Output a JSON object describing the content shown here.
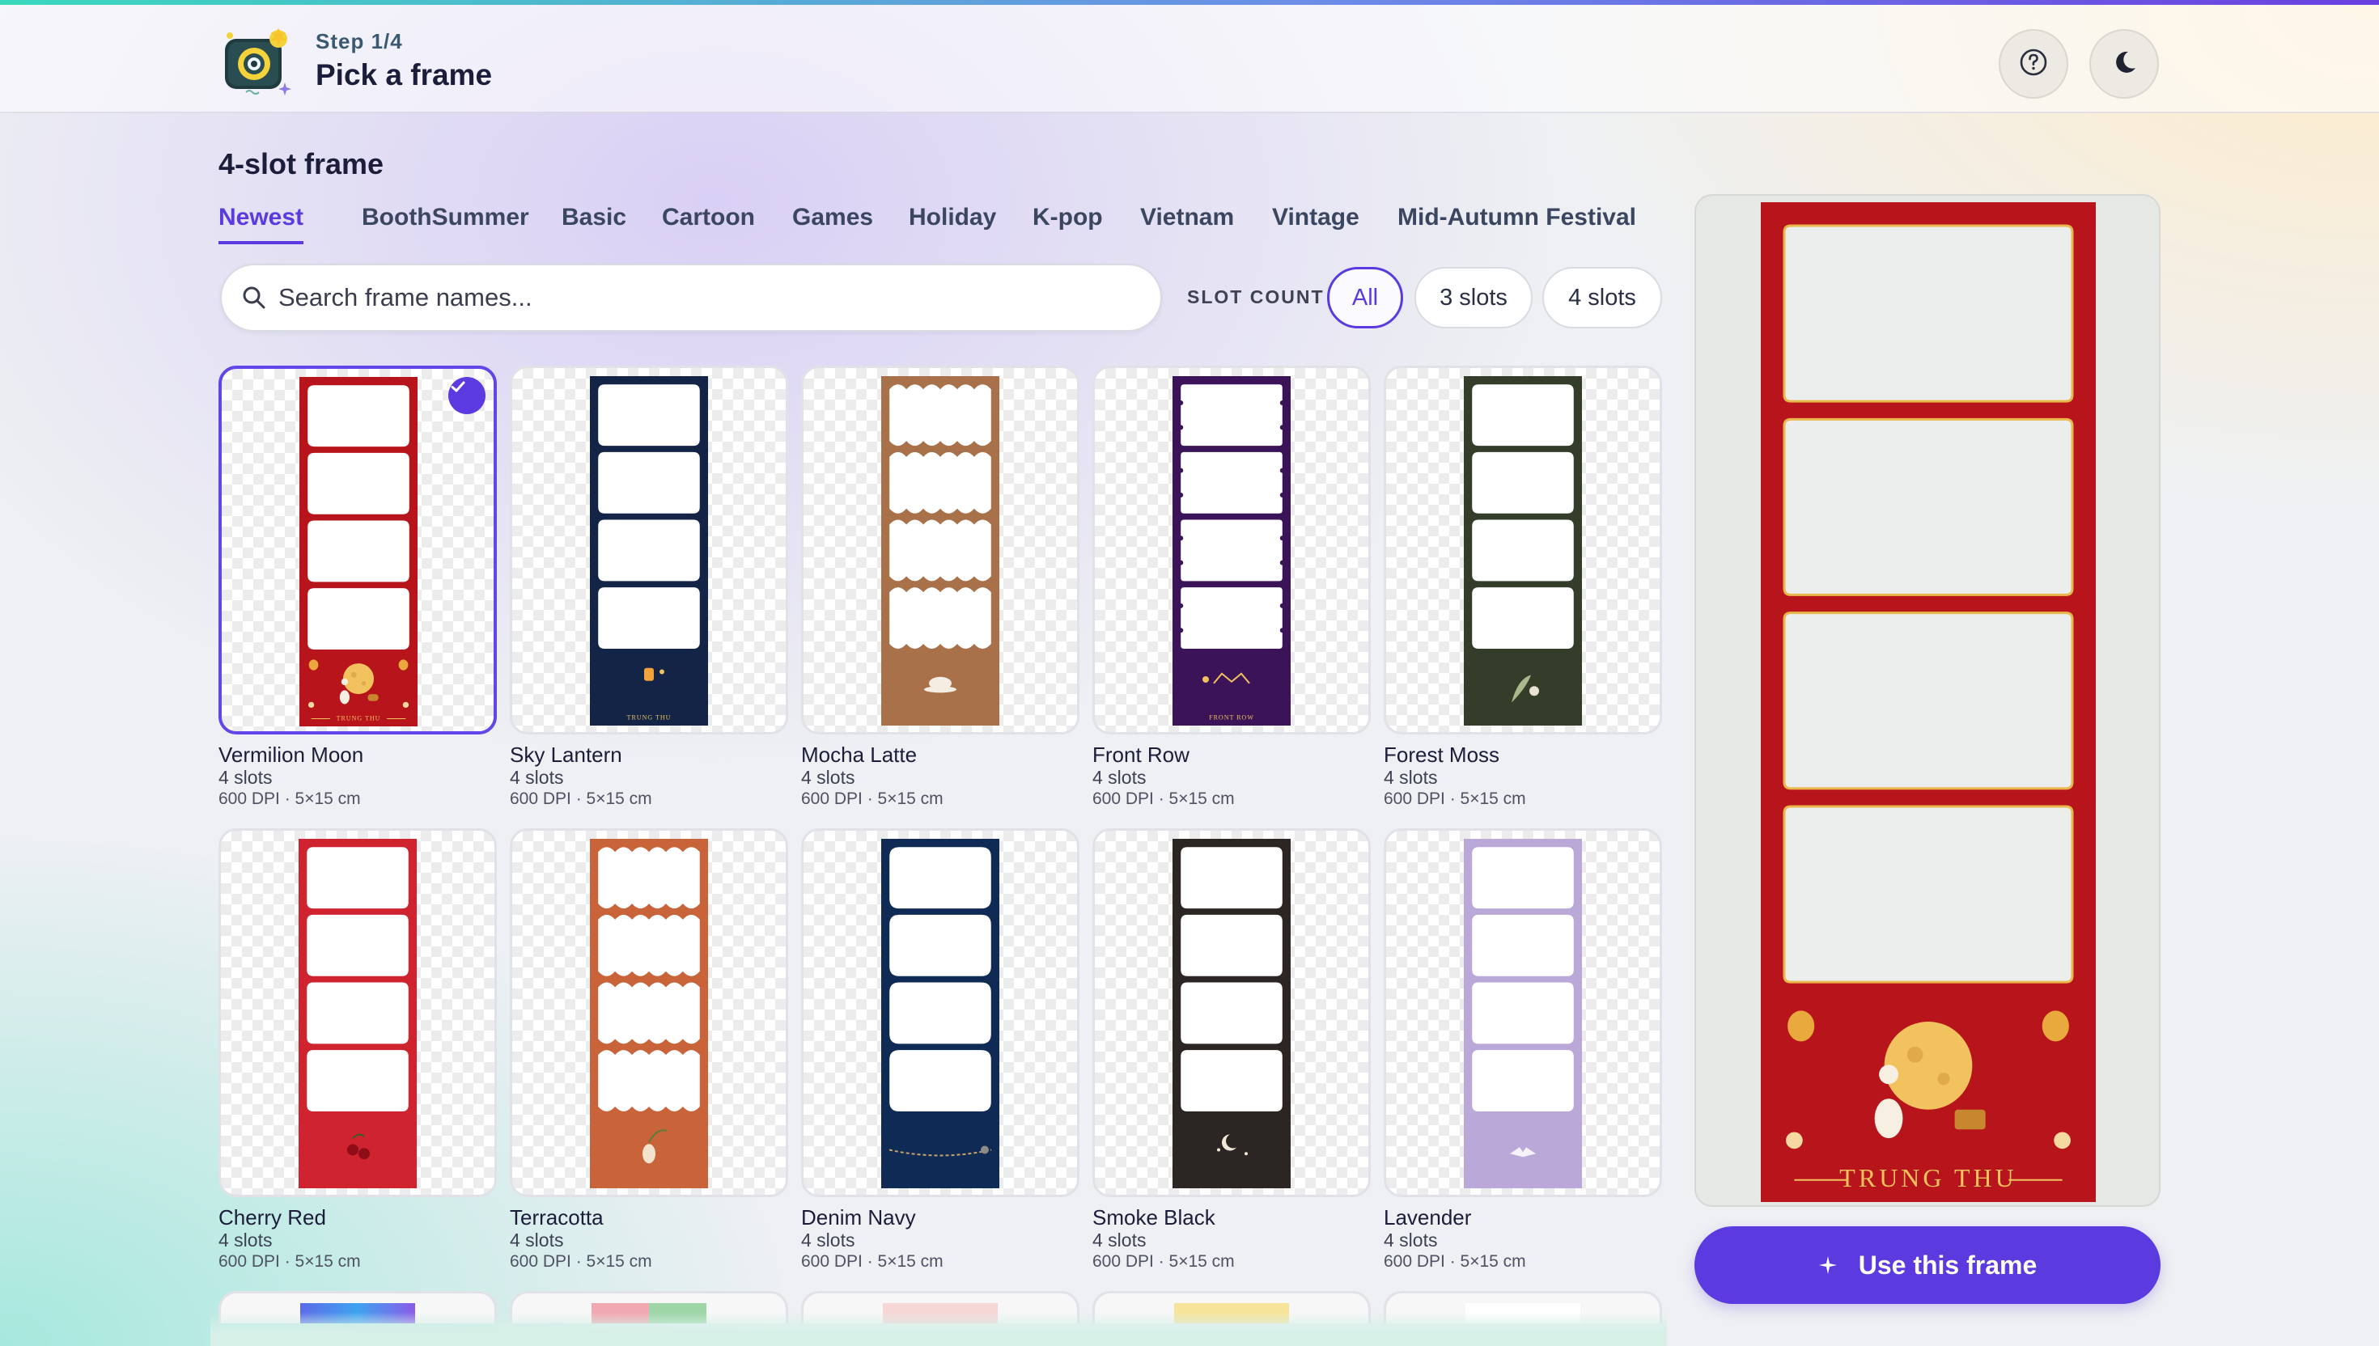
{
  "header": {
    "step": "Step 1/4",
    "title": "Pick a frame",
    "help_icon": "question-circle-icon",
    "theme_icon": "moon-icon"
  },
  "section_title": "4-slot frame",
  "tabs": [
    {
      "label": "Newest",
      "active": true
    },
    {
      "label": "BoothSummer"
    },
    {
      "label": "Basic"
    },
    {
      "label": "Cartoon"
    },
    {
      "label": "Games"
    },
    {
      "label": "Holiday"
    },
    {
      "label": "K-pop"
    },
    {
      "label": "Vietnam"
    },
    {
      "label": "Vintage"
    },
    {
      "label": "Mid-Autumn Festival"
    }
  ],
  "search": {
    "placeholder": "Search frame names...",
    "value": ""
  },
  "slot_filter": {
    "label": "SLOT COUNT",
    "options": [
      {
        "label": "All",
        "active": true
      },
      {
        "label": "3 slots"
      },
      {
        "label": "4 slots"
      }
    ]
  },
  "frames": [
    {
      "name": "Vermilion Moon",
      "slots": "4 slots",
      "meta": "600 DPI · 5×15 cm",
      "color": "#b8141c",
      "style": "square",
      "selected": true,
      "caption": "TRUNG THU"
    },
    {
      "name": "Sky Lantern",
      "slots": "4 slots",
      "meta": "600 DPI · 5×15 cm",
      "color": "#132447",
      "style": "square",
      "caption": "TRUNG THU"
    },
    {
      "name": "Mocha Latte",
      "slots": "4 slots",
      "meta": "600 DPI · 5×15 cm",
      "color": "#a9714a",
      "style": "wavy",
      "caption": ""
    },
    {
      "name": "Front Row",
      "slots": "4 slots",
      "meta": "600 DPI · 5×15 cm",
      "color": "#3a1358",
      "style": "ticket",
      "caption": "FRONT ROW"
    },
    {
      "name": "Forest Moss",
      "slots": "4 slots",
      "meta": "600 DPI · 5×15 cm",
      "color": "#343d2a",
      "style": "square",
      "caption": ""
    },
    {
      "name": "Cherry Red",
      "slots": "4 slots",
      "meta": "600 DPI · 5×15 cm",
      "color": "#cf2430",
      "style": "square",
      "caption": ""
    },
    {
      "name": "Terracotta",
      "slots": "4 slots",
      "meta": "600 DPI · 5×15 cm",
      "color": "#c9643a",
      "style": "wavy",
      "caption": ""
    },
    {
      "name": "Denim Navy",
      "slots": "4 slots",
      "meta": "600 DPI · 5×15 cm",
      "color": "#0f2a55",
      "style": "rounded",
      "caption": ""
    },
    {
      "name": "Smoke Black",
      "slots": "4 slots",
      "meta": "600 DPI · 5×15 cm",
      "color": "#2b2623",
      "style": "square",
      "caption": ""
    },
    {
      "name": "Lavender",
      "slots": "4 slots",
      "meta": "600 DPI · 5×15 cm",
      "color": "#b9a8d8",
      "style": "square",
      "caption": ""
    }
  ],
  "partial_row_colors": [
    "#5b6be8",
    "#f2a8b0",
    "#f4d6d6",
    "#f7e49b",
    "#ffffff"
  ],
  "preview": {
    "caption": "TRUNG THU",
    "color": "#b8141c"
  },
  "use_button": {
    "label": "Use this frame",
    "icon": "sparkle-icon"
  },
  "colors": {
    "accent": "#5b3be0"
  }
}
